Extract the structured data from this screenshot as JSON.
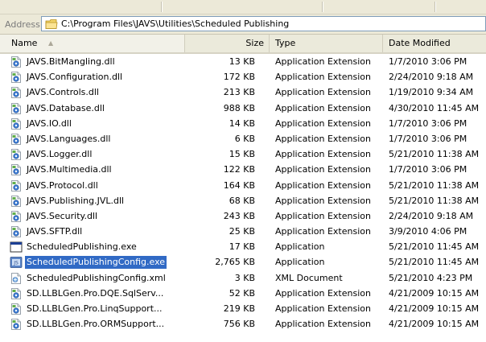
{
  "address": {
    "label": "Address",
    "path": "C:\\Program Files\\JAVS\\Utilities\\Scheduled Publishing"
  },
  "columns": {
    "name": "Name",
    "size": "Size",
    "type": "Type",
    "date": "Date Modified"
  },
  "files": [
    {
      "name": "JAVS.BitMangling.dll",
      "size": "13 KB",
      "type": "Application Extension",
      "date": "1/7/2010 3:06 PM",
      "icon": "dll-icon"
    },
    {
      "name": "JAVS.Configuration.dll",
      "size": "172 KB",
      "type": "Application Extension",
      "date": "2/24/2010 9:18 AM",
      "icon": "dll-icon"
    },
    {
      "name": "JAVS.Controls.dll",
      "size": "213 KB",
      "type": "Application Extension",
      "date": "1/19/2010 9:34 AM",
      "icon": "dll-icon"
    },
    {
      "name": "JAVS.Database.dll",
      "size": "988 KB",
      "type": "Application Extension",
      "date": "4/30/2010 11:45 AM",
      "icon": "dll-icon"
    },
    {
      "name": "JAVS.IO.dll",
      "size": "14 KB",
      "type": "Application Extension",
      "date": "1/7/2010 3:06 PM",
      "icon": "dll-icon"
    },
    {
      "name": "JAVS.Languages.dll",
      "size": "6 KB",
      "type": "Application Extension",
      "date": "1/7/2010 3:06 PM",
      "icon": "dll-icon"
    },
    {
      "name": "JAVS.Logger.dll",
      "size": "15 KB",
      "type": "Application Extension",
      "date": "5/21/2010 11:38 AM",
      "icon": "dll-icon"
    },
    {
      "name": "JAVS.Multimedia.dll",
      "size": "122 KB",
      "type": "Application Extension",
      "date": "1/7/2010 3:06 PM",
      "icon": "dll-icon"
    },
    {
      "name": "JAVS.Protocol.dll",
      "size": "164 KB",
      "type": "Application Extension",
      "date": "5/21/2010 11:38 AM",
      "icon": "dll-icon"
    },
    {
      "name": "JAVS.Publishing.JVL.dll",
      "size": "68 KB",
      "type": "Application Extension",
      "date": "5/21/2010 11:38 AM",
      "icon": "dll-icon"
    },
    {
      "name": "JAVS.Security.dll",
      "size": "243 KB",
      "type": "Application Extension",
      "date": "2/24/2010 9:18 AM",
      "icon": "dll-icon"
    },
    {
      "name": "JAVS.SFTP.dll",
      "size": "25 KB",
      "type": "Application Extension",
      "date": "3/9/2010 4:06 PM",
      "icon": "dll-icon"
    },
    {
      "name": "ScheduledPublishing.exe",
      "size": "17 KB",
      "type": "Application",
      "date": "5/21/2010 11:45 AM",
      "icon": "exe-icon"
    },
    {
      "name": "ScheduledPublishingConfig.exe",
      "size": "2,765 KB",
      "type": "Application",
      "date": "5/21/2010 11:45 AM",
      "icon": "config-exe-icon",
      "selected": true
    },
    {
      "name": "ScheduledPublishingConfig.xml",
      "size": "3 KB",
      "type": "XML Document",
      "date": "5/21/2010 4:23 PM",
      "icon": "xml-icon"
    },
    {
      "name": "SD.LLBLGen.Pro.DQE.SqlServ...",
      "size": "52 KB",
      "type": "Application Extension",
      "date": "4/21/2009 10:15 AM",
      "icon": "dll-icon"
    },
    {
      "name": "SD.LLBLGen.Pro.LinqSupport...",
      "size": "219 KB",
      "type": "Application Extension",
      "date": "4/21/2009 10:15 AM",
      "icon": "dll-icon"
    },
    {
      "name": "SD.LLBLGen.Pro.ORMSupport...",
      "size": "756 KB",
      "type": "Application Extension",
      "date": "4/21/2009 10:15 AM",
      "icon": "dll-icon"
    }
  ],
  "colors": {
    "selection": "#316ac5",
    "chrome": "#ece9d8"
  }
}
